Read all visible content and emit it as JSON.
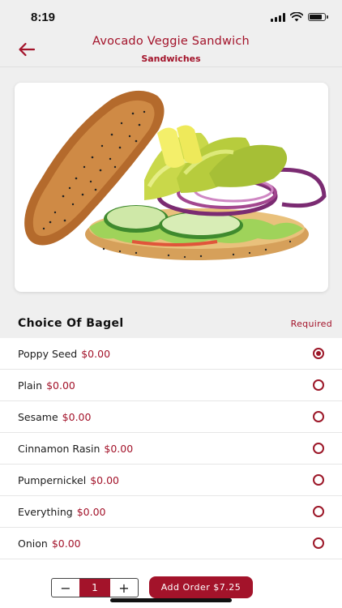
{
  "status_bar": {
    "time": "8:19",
    "icons": [
      "signal-icon",
      "wifi-icon",
      "battery-icon"
    ]
  },
  "header": {
    "back_icon": "arrow-left-icon",
    "title": "Avocado Veggie Sandwich",
    "subtitle": "Sandwiches"
  },
  "image": {
    "subject": "avocado-veggie-sandwich-photo"
  },
  "section": {
    "title": "Choice Of Bagel",
    "badge": "Required"
  },
  "options": [
    {
      "name": "Poppy Seed",
      "price": "$0.00",
      "selected": true
    },
    {
      "name": "Plain",
      "price": "$0.00",
      "selected": false
    },
    {
      "name": "Sesame",
      "price": "$0.00",
      "selected": false
    },
    {
      "name": "Cinnamon Rasin",
      "price": "$0.00",
      "selected": false
    },
    {
      "name": "Pumpernickel",
      "price": "$0.00",
      "selected": false
    },
    {
      "name": "Everything",
      "price": "$0.00",
      "selected": false
    },
    {
      "name": "Onion",
      "price": "$0.00",
      "selected": false
    }
  ],
  "order": {
    "minus_label": "−",
    "quantity": "1",
    "plus_label": "+",
    "add_label": "Add Order $7.25"
  },
  "colors": {
    "accent": "#a3132a",
    "background": "#efefef"
  }
}
